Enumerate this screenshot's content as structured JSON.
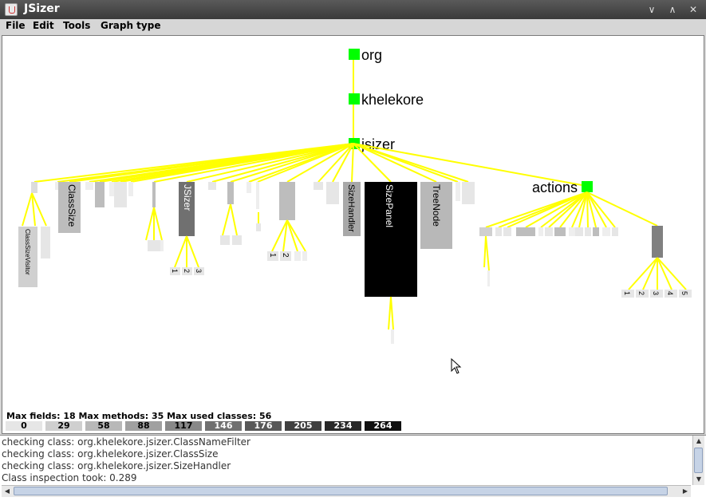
{
  "window": {
    "title": "JSizer",
    "buttons": [
      "∨",
      "∧",
      "✕"
    ]
  },
  "menu": [
    "File",
    "Edit",
    "Tools",
    "Graph type"
  ],
  "graph": {
    "line_color": "#ffff00",
    "package_color": "#00ff00",
    "packages": [
      "org",
      "khelekore",
      "jsizer",
      "actions"
    ],
    "classes": [
      "ClassSize",
      "JSizer",
      "SizeHandler",
      "SizePanel",
      "TreeNode",
      "ClassSizeVisitor"
    ],
    "labels_jsizer_children": [
      "1",
      "2",
      "3"
    ],
    "labels_mid_children": [
      "1",
      "2"
    ],
    "labels_right_children": [
      "1",
      "2",
      "3",
      "4",
      "5"
    ]
  },
  "stats": {
    "text": "Max fields: 18  Max methods: 35  Max used classes: 56"
  },
  "legend": [
    {
      "label": "0",
      "color": "#e6e6e6",
      "text": "#000"
    },
    {
      "label": "29",
      "color": "#cfcfcf",
      "text": "#000"
    },
    {
      "label": "58",
      "color": "#b8b8b8",
      "text": "#000"
    },
    {
      "label": "88",
      "color": "#a0a0a0",
      "text": "#000"
    },
    {
      "label": "117",
      "color": "#888888",
      "text": "#000"
    },
    {
      "label": "146",
      "color": "#707070",
      "text": "#fff"
    },
    {
      "label": "176",
      "color": "#585858",
      "text": "#fff"
    },
    {
      "label": "205",
      "color": "#404040",
      "text": "#fff"
    },
    {
      "label": "234",
      "color": "#282828",
      "text": "#fff"
    },
    {
      "label": "264",
      "color": "#101010",
      "text": "#fff"
    }
  ],
  "log": [
    "checking class: org.khelekore.jsizer.ClassNameFilter",
    "checking class: org.khelekore.jsizer.ClassSize",
    "checking class: org.khelekore.jsizer.SizeHandler",
    "Class inspection took: 0.289"
  ]
}
